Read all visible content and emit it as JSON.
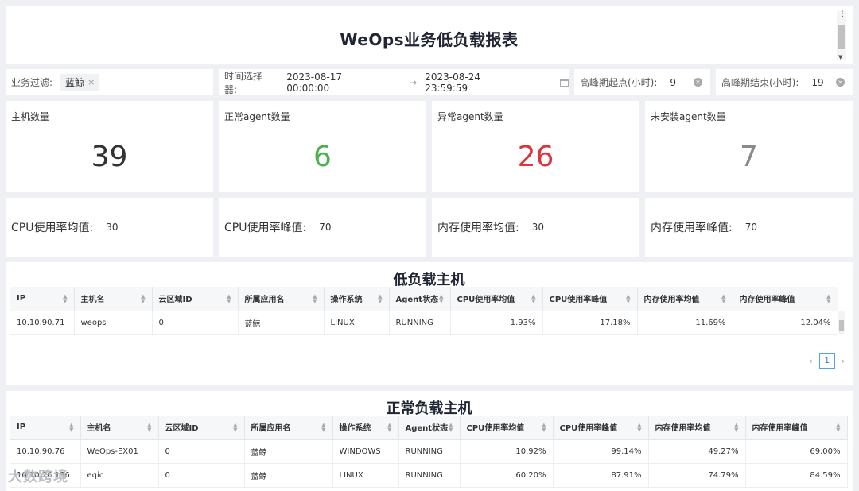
{
  "report": {
    "title": "WeOps业务低负载报表"
  },
  "filters": {
    "business": {
      "label": "业务过滤:",
      "tag": "蓝鲸"
    },
    "time": {
      "label": "时间选择器:",
      "start": "2023-08-17 00:00:00",
      "arrow": "→",
      "end": "2023-08-24 23:59:59"
    },
    "peak_start": {
      "label": "高峰期起点(小时):",
      "value": "9"
    },
    "peak_end": {
      "label": "高峰期结束(小时):",
      "value": "19"
    }
  },
  "stats": [
    {
      "label": "主机数量",
      "value": "39",
      "color": "#333333"
    },
    {
      "label": "正常agent数量",
      "value": "6",
      "color": "#4caf50"
    },
    {
      "label": "异常agent数量",
      "value": "26",
      "color": "#d9363e"
    },
    {
      "label": "未安装agent数量",
      "value": "7",
      "color": "#8a8a8a"
    }
  ],
  "metrics": [
    {
      "label": "CPU使用率均值:",
      "value": "30"
    },
    {
      "label": "CPU使用率峰值:",
      "value": "70"
    },
    {
      "label": "内存使用率均值:",
      "value": "30"
    },
    {
      "label": "内存使用率峰值:",
      "value": "70"
    }
  ],
  "low_load": {
    "title": "低负载主机",
    "columns": [
      "IP",
      "主机名",
      "云区域ID",
      "所属应用名",
      "操作系统",
      "Agent状态",
      "CPU使用率均值",
      "CPU使用率峰值",
      "内存使用率均值",
      "内存使用率峰值"
    ],
    "rows": [
      [
        "10.10.90.71",
        "weops",
        "0",
        "蓝鲸",
        "LINUX",
        "RUNNING",
        "1.93%",
        "17.18%",
        "11.69%",
        "12.04%"
      ]
    ],
    "page": "1"
  },
  "normal_load": {
    "title": "正常负载主机",
    "columns": [
      "IP",
      "主机名",
      "云区域ID",
      "所属应用名",
      "操作系统",
      "Agent状态",
      "CPU使用率均值",
      "CPU使用率峰值",
      "内存使用率均值",
      "内存使用率峰值"
    ],
    "rows": [
      [
        "10.10.90.76",
        "WeOps-EX01",
        "0",
        "蓝鲸",
        "WINDOWS",
        "RUNNING",
        "10.92%",
        "99.14%",
        "49.27%",
        "69.00%"
      ],
      [
        "10.10.26.136",
        "eqic",
        "0",
        "蓝鲸",
        "LINUX",
        "RUNNING",
        "60.20%",
        "87.91%",
        "74.79%",
        "84.59%"
      ]
    ]
  },
  "watermark": "大数跨境"
}
